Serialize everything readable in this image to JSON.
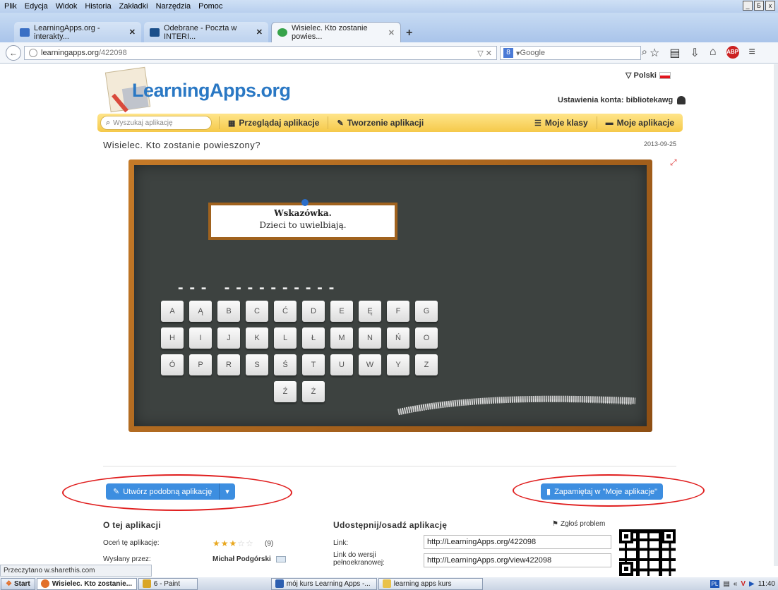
{
  "menubar": {
    "items": [
      "Plik",
      "Edycja",
      "Widok",
      "Historia",
      "Zakładki",
      "Narzędzia",
      "Pomoc"
    ],
    "window_buttons": [
      "_",
      "Б",
      "x"
    ]
  },
  "tabs": [
    {
      "label": "LearningApps.org - interakty...",
      "icon": "learningapps-icon",
      "color": "#3a6fc4"
    },
    {
      "label": "Odebrane - Poczta w INTERI...",
      "icon": "interia-icon",
      "color": "#1b4f8a"
    },
    {
      "label": "Wisielec. Kto zostanie powies...",
      "icon": "loading-icon",
      "color": "#37a34a"
    }
  ],
  "newtab_label": "+",
  "navbar": {
    "back": "←",
    "url_domain": "learningapps.org",
    "url_path": "/422098",
    "url_right": "▽ ✕",
    "search_placeholder": "Google",
    "search_engine": "8",
    "icons": [
      "star-icon",
      "bookmarks-icon",
      "download-icon",
      "home-icon"
    ],
    "abp_label": "ABP",
    "menu_glyph": "≡"
  },
  "site": {
    "language": "▽ Polski",
    "logo": "LearningApps.org",
    "account": "Ustawienia konta: bibliotekawg",
    "search_placeholder": "Wyszukaj aplikację",
    "nav": [
      "Przeglądaj aplikacje",
      "Tworzenie aplikacji",
      "Moje klasy",
      "Moje aplikacje"
    ],
    "nav_glyphs": [
      "▦",
      "✎",
      "☰",
      "▬"
    ]
  },
  "app": {
    "title": "Wisielec. Kto zostanie powieszony?",
    "date": "2013-09-25",
    "fullscreen": "⤢",
    "hint_title": "Wskazówka.",
    "hint_text": "Dzieci to uwielbiają.",
    "dashes": "--- ----------",
    "keys": [
      "A",
      "Ą",
      "B",
      "C",
      "Ć",
      "D",
      "E",
      "Ę",
      "F",
      "G",
      "H",
      "I",
      "J",
      "K",
      "L",
      "Ł",
      "M",
      "N",
      "Ń",
      "O",
      "Ó",
      "P",
      "R",
      "S",
      "Ś",
      "T",
      "U",
      "W",
      "Y",
      "Z",
      "Ź",
      "Ż"
    ]
  },
  "actions": {
    "create_similar": "Utwórz podobną aplikację",
    "create_caret": "▾",
    "save": "Zapamiętaj w \"Moje aplikacje\""
  },
  "about": {
    "heading": "O tej aplikacji",
    "rate_label": "Oceń tę aplikację:",
    "rating_value": 3,
    "rating_max": 5,
    "stars_filled": "★★★",
    "stars_empty": "☆☆",
    "rating_count": "(9)",
    "sent_by_label": "Wysłany przez:",
    "author": "Michał Podgórski"
  },
  "share": {
    "heading": "Udostępnij/osadź aplikację",
    "report": "Zgłoś problem",
    "report_glyph": "⚑",
    "link_label": "Link:",
    "link_value": "http://LearningApps.org/422098",
    "full_label_1": "Link do wersji",
    "full_label_2": "pełnoekranowej:",
    "full_value": "http://LearningApps.org/view422098"
  },
  "status_text": "Przeczytano w.sharethis.com",
  "taskbar": {
    "start": "Start",
    "items": [
      {
        "label": "Wisielec. Kto zostanie...",
        "color": "#e2702a",
        "active": true
      },
      {
        "label": "6 - Paint",
        "color": "#d9a627",
        "active": false
      },
      {
        "label": "mój kurs Learning Apps -...",
        "color": "#2d5fb0",
        "active": false
      },
      {
        "label": "learning apps kurs",
        "color": "#e9c24a",
        "active": false
      }
    ],
    "lang": "PL",
    "clock": "11:40"
  },
  "colors": {
    "accent": "#3d8ee0",
    "nav_yellow": "#f5c94a",
    "board": "#3d4240",
    "frame": "#a0621e",
    "annotation": "#e01f1f"
  }
}
